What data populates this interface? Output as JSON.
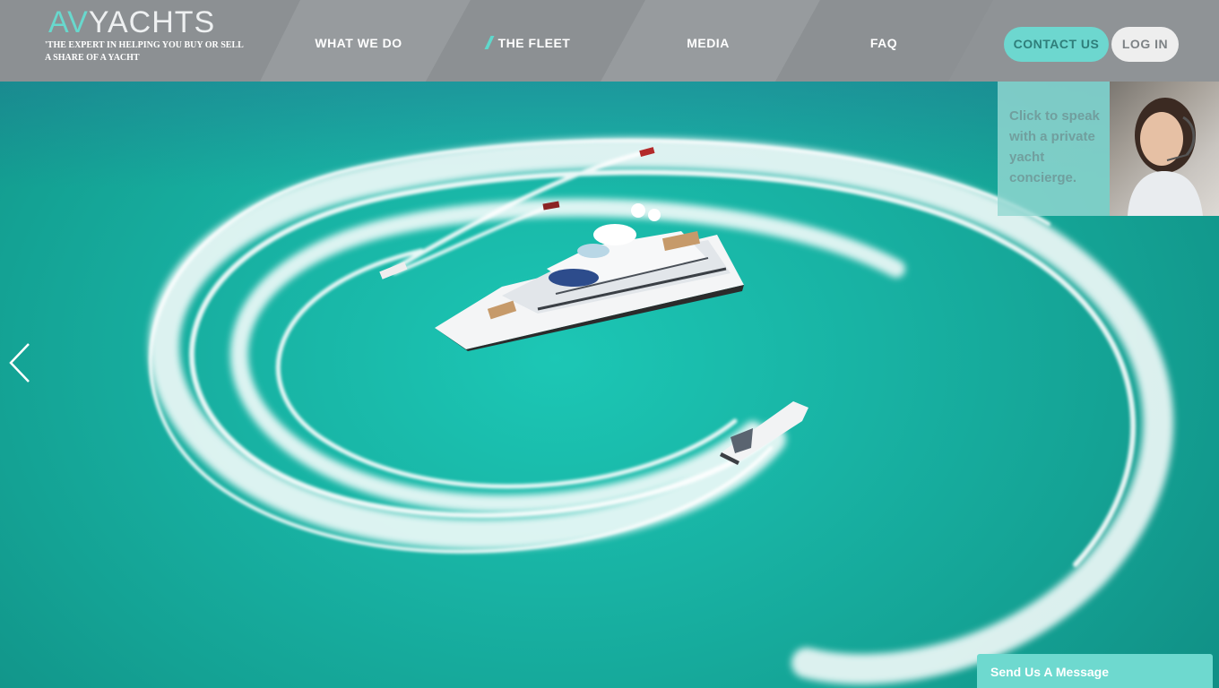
{
  "brand": {
    "logo_prefix": "AV",
    "logo_word": "YACHTS",
    "tagline_line1": "'THE EXPERT IN HELPING YOU BUY OR SELL",
    "tagline_line2": "A SHARE OF A YACHT"
  },
  "nav": {
    "items": [
      {
        "label": "WHAT WE DO"
      },
      {
        "label": "THE FLEET",
        "active": true
      },
      {
        "label": "MEDIA"
      },
      {
        "label": "FAQ"
      }
    ]
  },
  "actions": {
    "contact_label": "CONTACT US",
    "login_label": "LOG IN"
  },
  "concierge": {
    "text": "Click to speak with a private yacht concierge."
  },
  "chat": {
    "label": "Send Us A Message"
  },
  "colors": {
    "accent": "#6dd7cf",
    "header_bg": "#8c9093",
    "water": "#1ab3a5"
  },
  "icons": {
    "carousel_prev": "chevron-left-icon"
  }
}
